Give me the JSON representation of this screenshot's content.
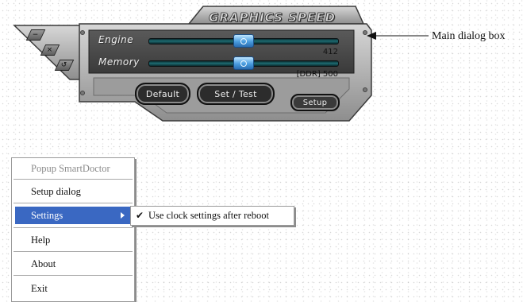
{
  "dialog": {
    "title": "GRAPHICS SPEED",
    "side_buttons": [
      {
        "symbol": "−"
      },
      {
        "symbol": "×"
      },
      {
        "symbol": "↺"
      }
    ],
    "sliders": [
      {
        "label": "Engine",
        "value": "412",
        "position_fraction": 0.5
      },
      {
        "label": "Memory",
        "value": "[DDR] 500",
        "position_fraction": 0.5
      }
    ],
    "buttons": {
      "default": "Default",
      "set_test": "Set / Test",
      "setup": "Setup"
    },
    "colors": {
      "panel": "#b8b8b8",
      "dark_panel": "#4a4a4a",
      "thumb": "#4a9de0",
      "track": "#1e6c72"
    }
  },
  "callout": {
    "label": "Main dialog box"
  },
  "menu": {
    "items": [
      {
        "label": "Popup SmartDoctor",
        "state": "disabled"
      },
      {
        "label": "Setup dialog",
        "state": "normal"
      },
      {
        "label": "Settings",
        "state": "highlighted",
        "has_submenu": true
      },
      {
        "label": "Help",
        "state": "normal"
      },
      {
        "label": "About",
        "state": "normal"
      },
      {
        "label": "Exit",
        "state": "normal"
      }
    ],
    "highlight_color": "#3a68c2"
  },
  "submenu": {
    "items": [
      {
        "label": "Use clock settings after reboot",
        "checked": true,
        "check_mark": "✔"
      }
    ]
  }
}
